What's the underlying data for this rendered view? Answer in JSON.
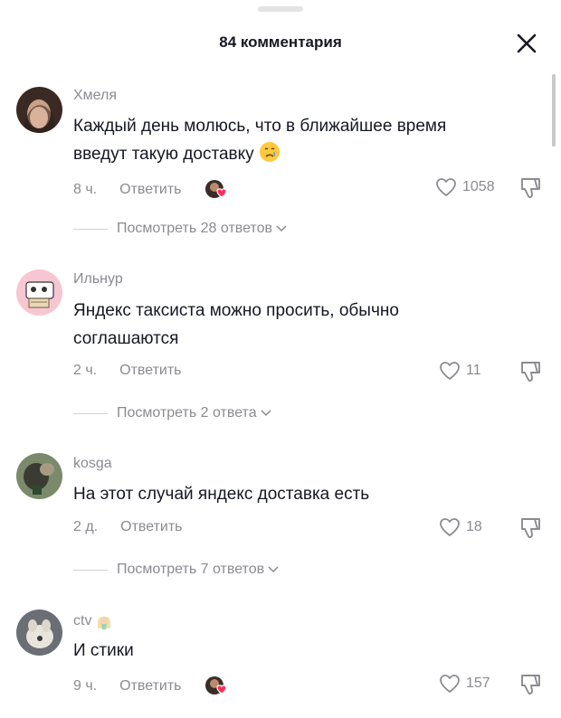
{
  "header": {
    "title": "84 комментария"
  },
  "comments": [
    {
      "username": "Хмеля",
      "text_line1": "Каждый день молюсь, что в ближайшее время",
      "text_line2": "введут такую доставку",
      "time": "8 ч.",
      "reply_label": "Ответить",
      "likes": "1058",
      "view_replies": "Посмотреть 28 ответов"
    },
    {
      "username": "Ильнур",
      "text_line1": "Яндекс таксиста можно просить, обычно",
      "text_line2": "соглашаются",
      "time": "2 ч.",
      "reply_label": "Ответить",
      "likes": "11",
      "view_replies": "Посмотреть 2 ответа"
    },
    {
      "username": "kosga",
      "text_line1": "На этот случай яндекс доставка есть",
      "time": "2 д.",
      "reply_label": "Ответить",
      "likes": "18",
      "view_replies": "Посмотреть 7 ответов"
    },
    {
      "username": "ctv",
      "text_line1": "И стики",
      "time": "9 ч.",
      "reply_label": "Ответить",
      "likes": "157"
    }
  ],
  "icons": {
    "close": "close-icon",
    "like": "heart-outline-icon",
    "dislike": "thumbs-down-icon",
    "chevron": "chevron-down-icon",
    "creator_like": "creator-liked-badge-icon"
  },
  "colors": {
    "text": "#161823",
    "secondary": "#8a8b91",
    "heart": "#fe2c55"
  }
}
